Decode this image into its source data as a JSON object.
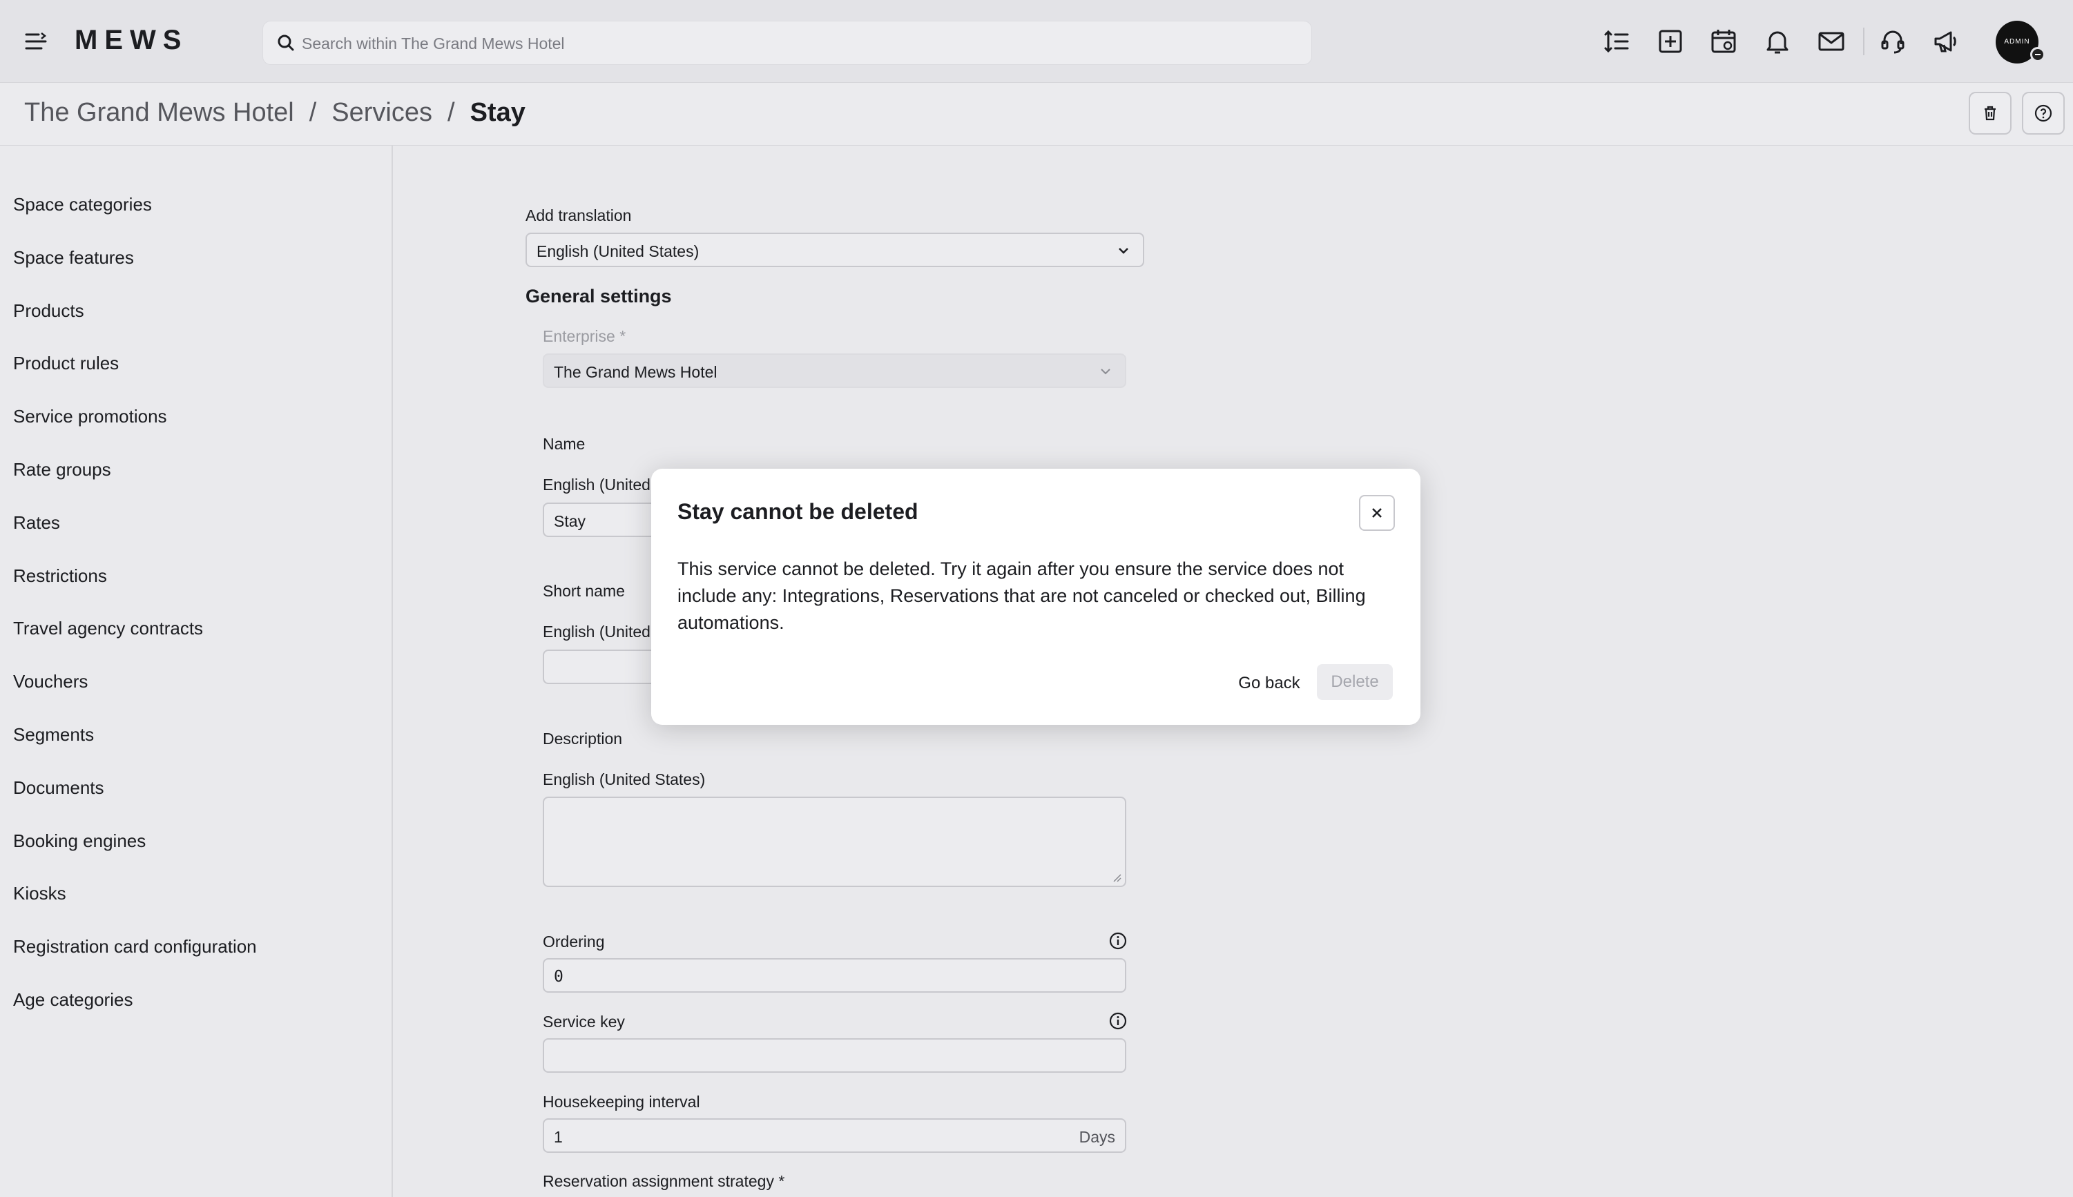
{
  "header": {
    "logo": "MEWS",
    "search_placeholder": "Search within The Grand Mews Hotel",
    "avatar_text": "ADMIN",
    "icons": [
      "menu-icon",
      "search-icon",
      "sort-icon",
      "add-icon",
      "calendar-icon",
      "bell-icon",
      "mail-icon",
      "support-icon",
      "megaphone-icon"
    ]
  },
  "breadcrumb": {
    "items": [
      "The Grand Mews Hotel",
      "Services"
    ],
    "separator": "/",
    "current": "Stay"
  },
  "sidebar": {
    "items": [
      "Space categories",
      "Space features",
      "Products",
      "Product rules",
      "Service promotions",
      "Rate groups",
      "Rates",
      "Restrictions",
      "Travel agency contracts",
      "Vouchers",
      "Segments",
      "Documents",
      "Booking engines",
      "Kiosks",
      "Registration card configuration",
      "Age categories"
    ]
  },
  "form": {
    "add_translation_label": "Add translation",
    "add_translation_value": "English (United States)",
    "general_settings_title": "General settings",
    "enterprise_label": "Enterprise *",
    "enterprise_value": "The Grand Mews Hotel",
    "name_label": "Name",
    "name_locale": "English (United States)",
    "name_value": "Stay",
    "short_name_label": "Short name",
    "short_name_locale": "English (United States)",
    "short_name_value": "",
    "description_label": "Description",
    "description_locale": "English (United States)",
    "description_value": "",
    "ordering_label": "Ordering",
    "ordering_value": "0",
    "service_key_label": "Service key",
    "service_key_value": "",
    "housekeeping_label": "Housekeeping interval",
    "housekeeping_value": "1",
    "housekeeping_suffix": "Days",
    "reservation_strategy_label": "Reservation assignment strategy *"
  },
  "modal": {
    "title": "Stay cannot be deleted",
    "body": "This service cannot be deleted. Try it again after you ensure the service does not include any: Integrations, Reservations that are not canceled or checked out, Billing automations.",
    "go_back": "Go back",
    "delete": "Delete"
  }
}
